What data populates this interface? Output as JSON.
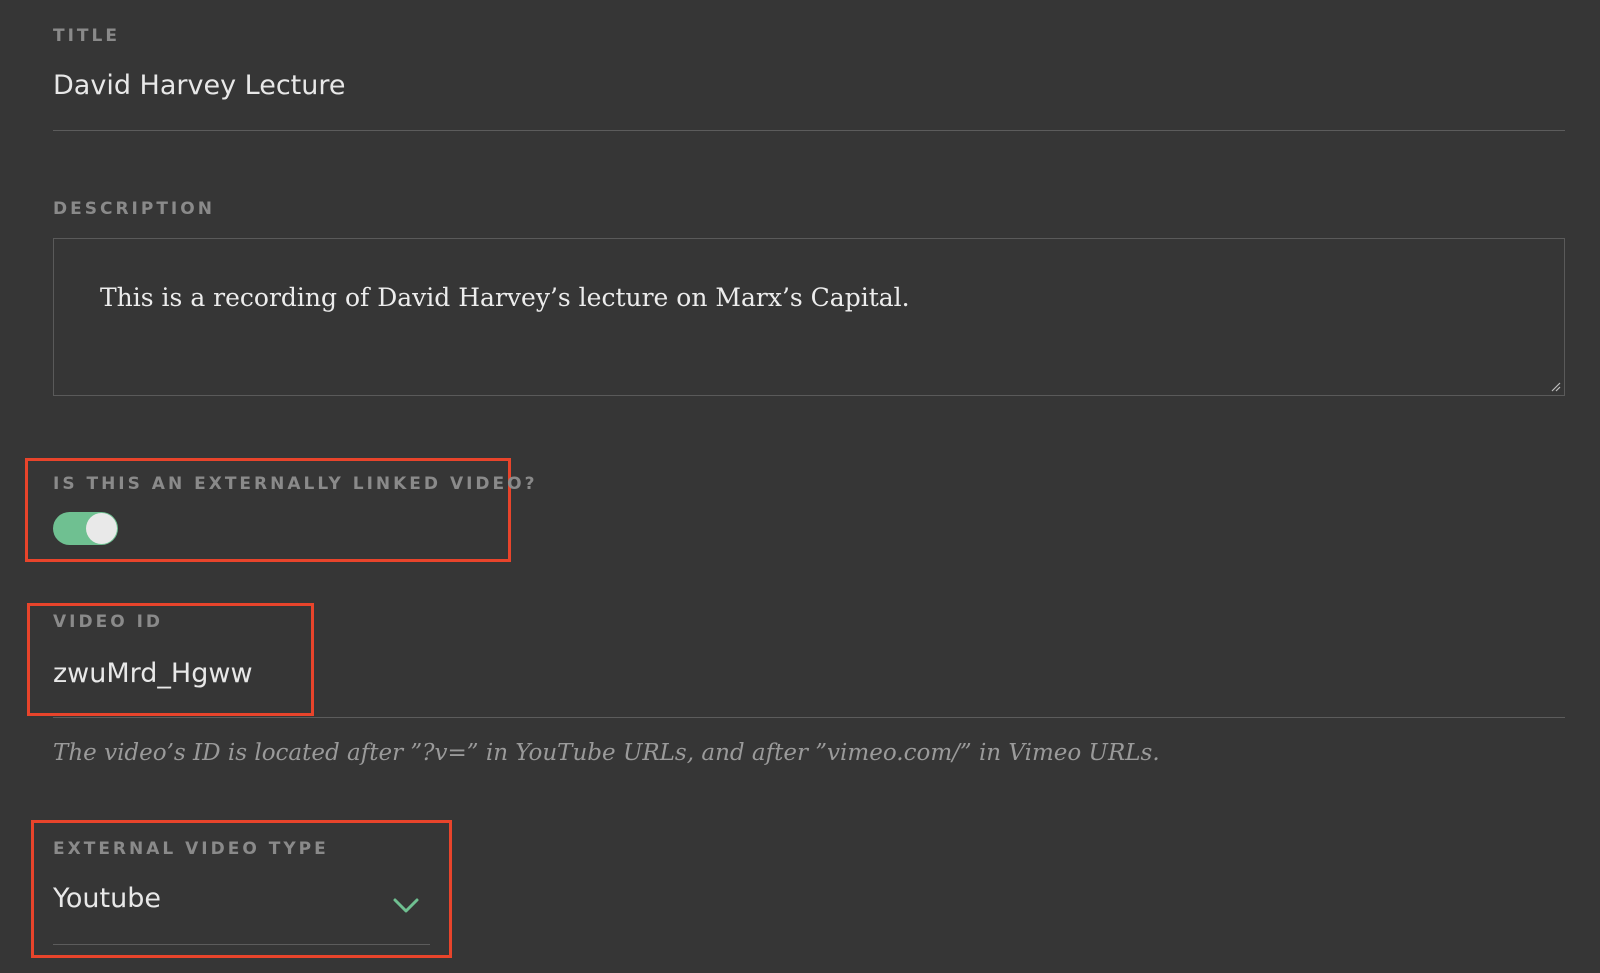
{
  "form": {
    "title": {
      "label": "TITLE",
      "value": "David Harvey Lecture"
    },
    "description": {
      "label": "DESCRIPTION",
      "value": "This is a recording of David Harvey’s lecture on Marx’s Capital."
    },
    "external_link": {
      "label": "IS THIS AN EXTERNALLY LINKED VIDEO?",
      "enabled": true
    },
    "video_id": {
      "label": "VIDEO ID",
      "value": "zwuMrd_Hgww",
      "hint": "The video’s ID is located after ”?v=” in YouTube URLs, and after ”vimeo.com/” in Vimeo URLs."
    },
    "video_type": {
      "label": "EXTERNAL VIDEO TYPE",
      "selected": "Youtube",
      "icon": "chevron-down-icon"
    }
  },
  "colors": {
    "background": "#363636",
    "accent": "#6fc091",
    "highlight": "#e8442b"
  }
}
